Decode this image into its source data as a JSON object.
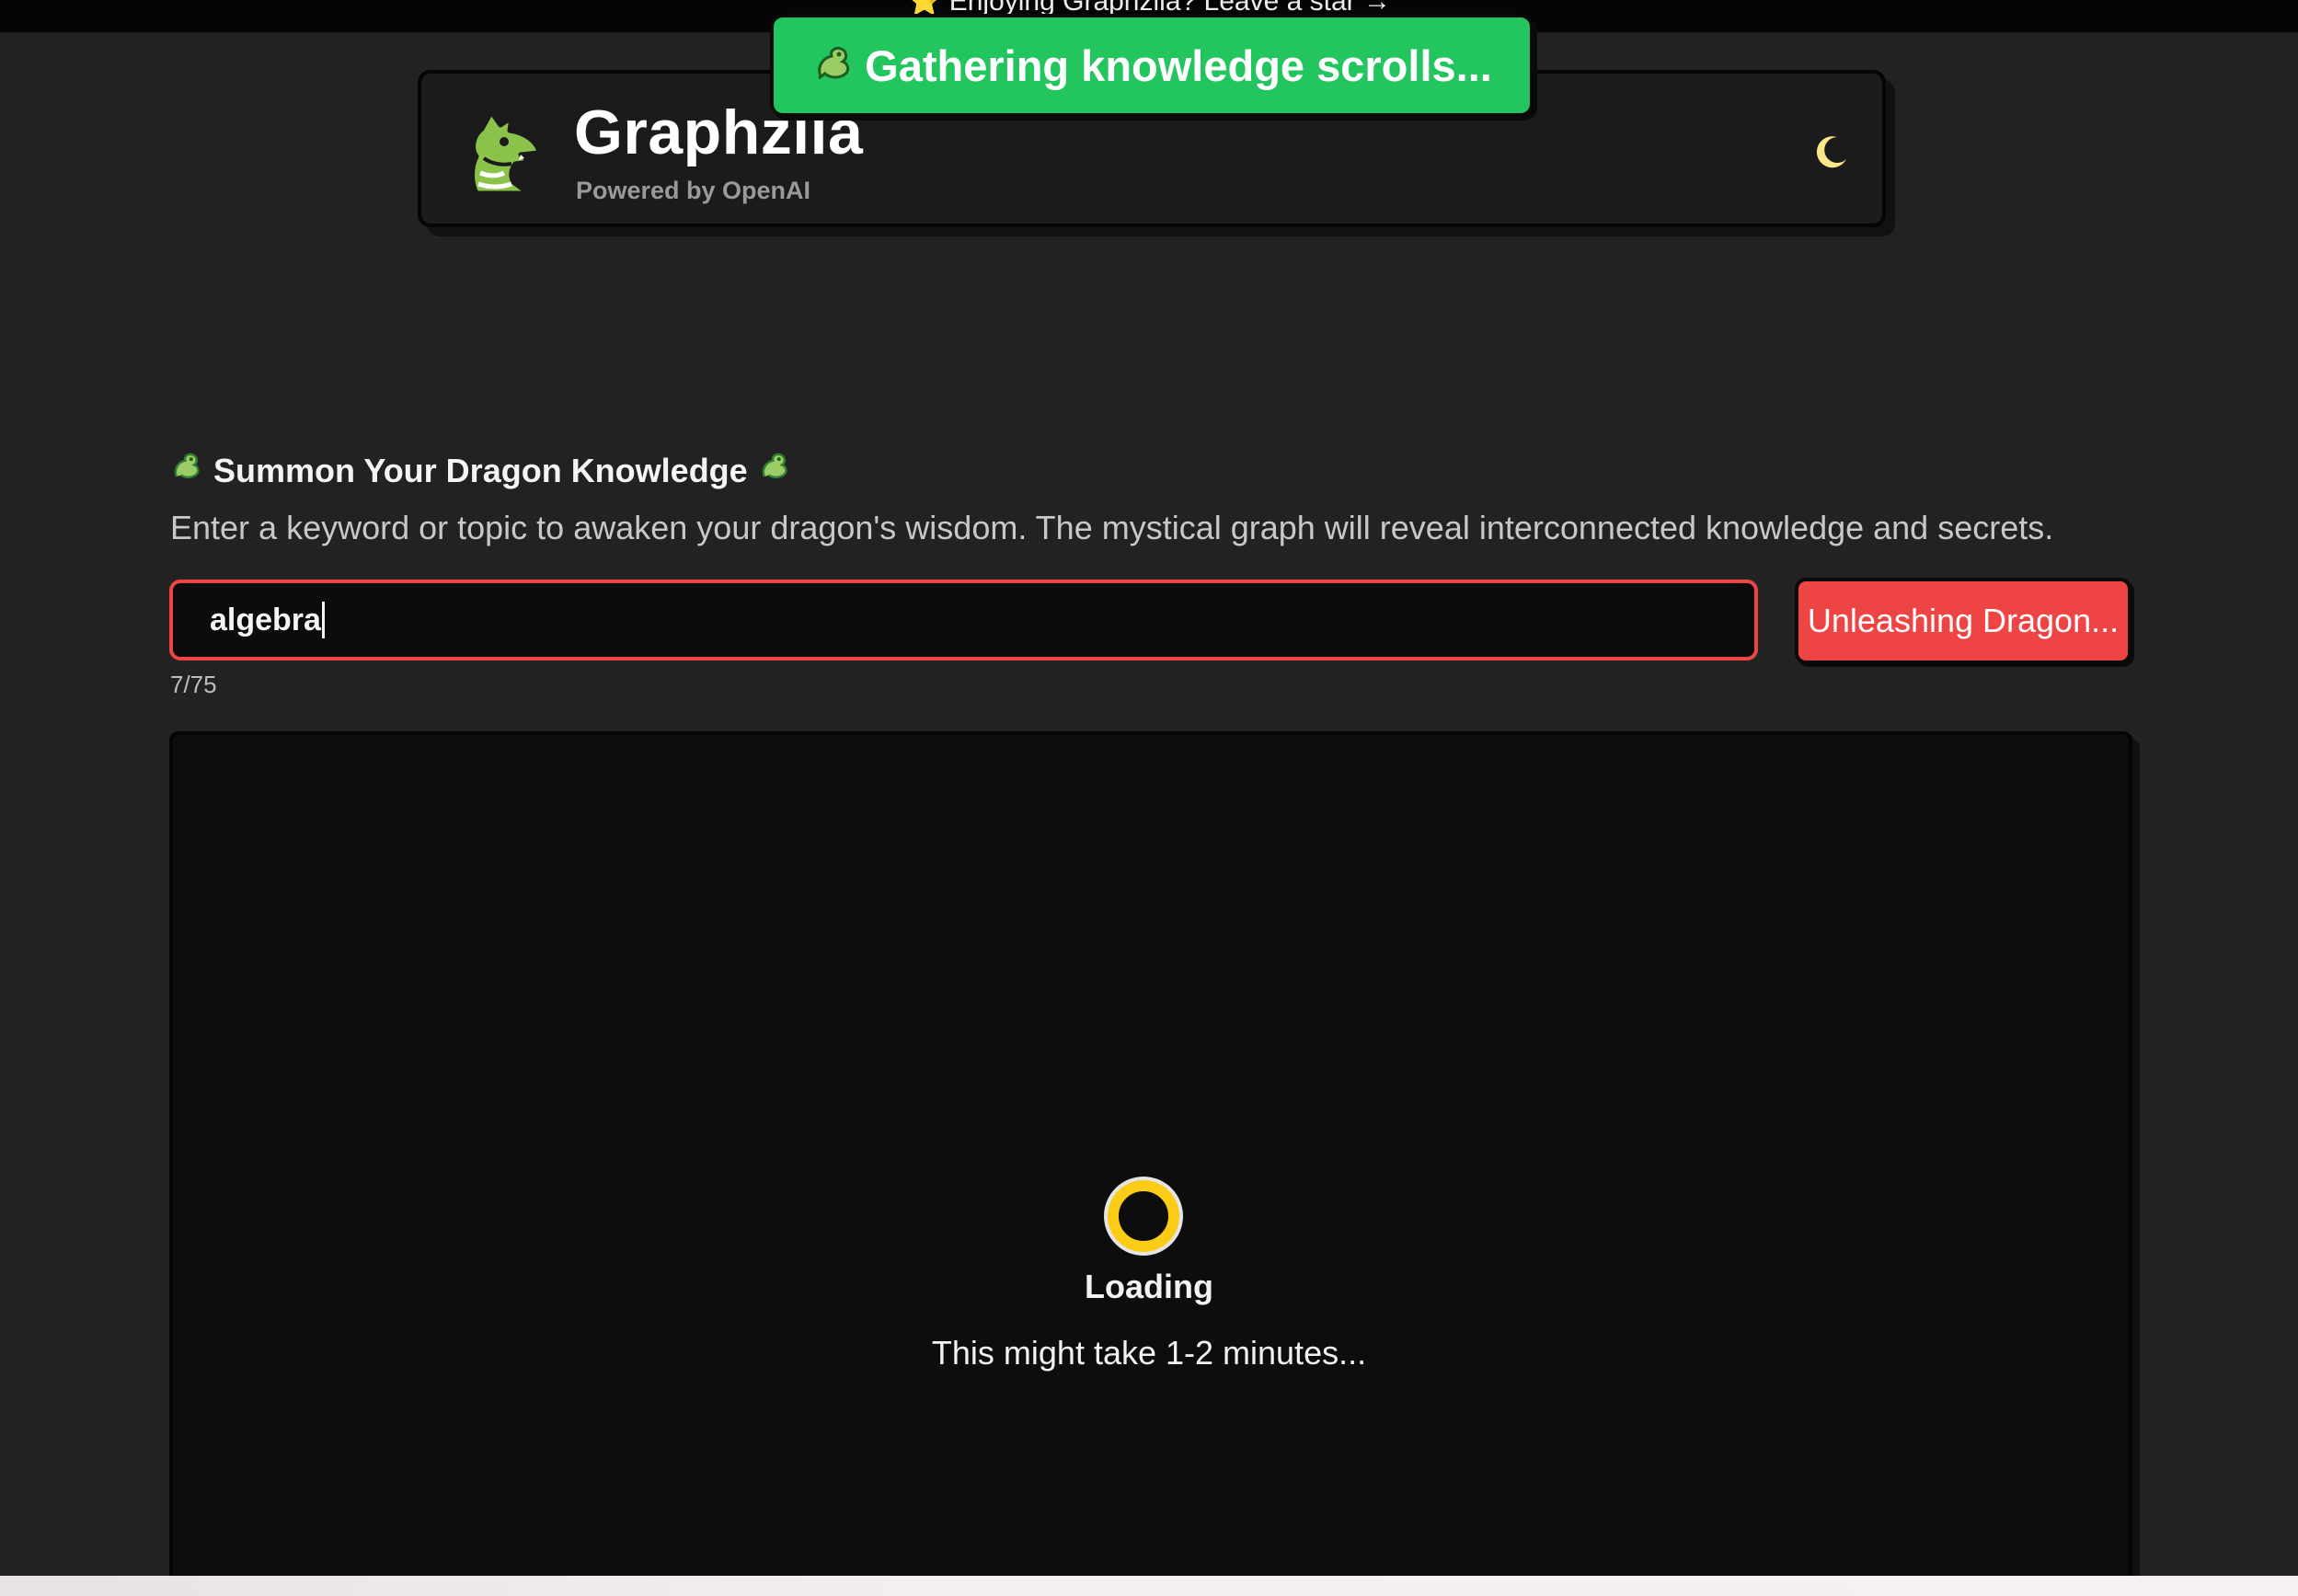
{
  "banner": {
    "text": "⭐ Enjoying Graphzila? Leave a star →"
  },
  "header": {
    "logo_icon": "dragon-logo-icon",
    "title": "Graphzila",
    "subtitle": "Powered by OpenAI",
    "theme_toggle_icon": "moon-icon"
  },
  "toast": {
    "text": "Gathering knowledge scrolls..."
  },
  "summon": {
    "title": "Summon Your Dragon Knowledge",
    "description": "Enter a keyword or topic to awaken your dragon's wisdom. The mystical graph will reveal interconnected knowledge and secrets.",
    "input_value": "algebra",
    "char_count": "7/75",
    "button_label": "Unleashing Dragon..."
  },
  "graph": {
    "loading_label": "Loading",
    "loading_note": "This might take 1-2 minutes..."
  },
  "colors": {
    "background": "#222222",
    "toast": "#22c55e",
    "accent_red": "#ef4444",
    "spinner_yellow": "#facc15",
    "moon": "#fde68a"
  }
}
